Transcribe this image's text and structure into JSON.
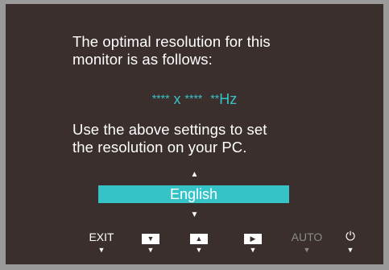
{
  "message": {
    "line1": "The optimal resolution for this",
    "line2": "monitor is as follows:",
    "resolution_w": "****",
    "resolution_sep": " x ",
    "resolution_h": "****",
    "refresh_stars": "**",
    "refresh_unit": "Hz",
    "line3": "Use the above settings to set",
    "line4": "the resolution on your PC."
  },
  "language": {
    "selected": "English",
    "up_glyph": "▲",
    "down_glyph": "▼"
  },
  "buttons": [
    {
      "label": "EXIT",
      "enabled": true
    },
    {
      "icon": "down-triangle-icon",
      "glyph": "▼",
      "enabled": true
    },
    {
      "icon": "up-triangle-icon",
      "glyph": "▲",
      "enabled": true
    },
    {
      "icon": "right-triangle-icon",
      "glyph": "▶",
      "enabled": true
    },
    {
      "label": "AUTO",
      "enabled": false
    },
    {
      "icon": "power-icon",
      "glyph": "⏻",
      "enabled": true
    }
  ],
  "button_indicator_glyph": "▼",
  "colors": {
    "background": "#3a2f2c",
    "accent": "#36c3c8",
    "bezel": "#9a9a9a",
    "disabled": "#8a8a8a"
  }
}
